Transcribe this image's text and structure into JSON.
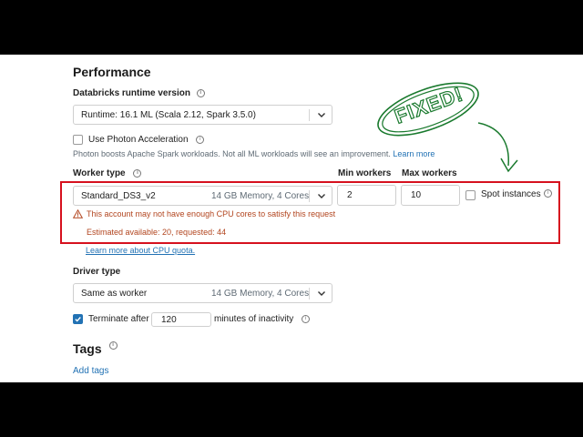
{
  "performance": {
    "title": "Performance",
    "runtime_label": "Databricks runtime version",
    "runtime_value": "Runtime: 16.1 ML (Scala 2.12, Spark 3.5.0)",
    "photon_label": "Use Photon Acceleration",
    "photon_checked": false,
    "photon_desc": "Photon boosts Apache Spark workloads. Not all ML workloads will see an improvement.",
    "learn_more": "Learn more",
    "worker_type_label": "Worker type",
    "min_workers_label": "Min workers",
    "max_workers_label": "Max workers",
    "worker_type_value": "Standard_DS3_v2",
    "worker_type_meta": "14 GB Memory, 4 Cores",
    "min_workers_value": "2",
    "max_workers_value": "10",
    "spot_label": "Spot instances",
    "spot_checked": false,
    "warning_text": "This account may not have enough CPU cores to satisfy this request",
    "estimate_text": "Estimated available: 20, requested: 44",
    "quota_link": "Learn more about CPU quota.",
    "driver_type_label": "Driver type",
    "driver_type_value": "Same as worker",
    "driver_type_meta": "14 GB Memory, 4 Cores",
    "terminate_label": "Terminate after",
    "terminate_value": "120",
    "terminate_suffix": "minutes of inactivity",
    "terminate_checked": true
  },
  "tags": {
    "title": "Tags",
    "add_link": "Add tags"
  },
  "annotation": {
    "stamp_text": "FIXED!",
    "stamp_color": "#1a7a2e",
    "highlight_color": "#d6111e"
  }
}
